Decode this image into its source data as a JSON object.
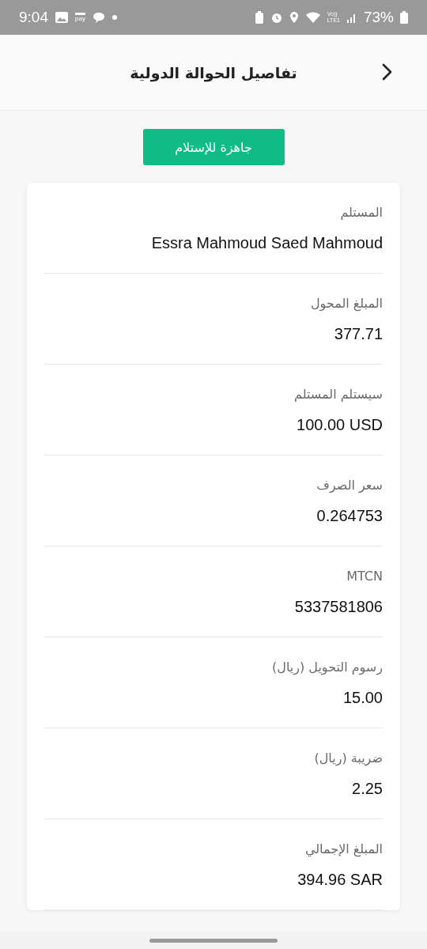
{
  "status_bar": {
    "time": "9:04",
    "pay_label": "pay",
    "volte": "Vo))",
    "network": "LTE1",
    "battery": "73%"
  },
  "header": {
    "title": "تفاصيل الحوالة الدولية"
  },
  "status_button": {
    "label": "جاهزة للإستلام"
  },
  "details": [
    {
      "label": "المستلم",
      "value": "Essra Mahmoud Saed Mahmoud"
    },
    {
      "label": "المبلغ المحول",
      "value": "377.71"
    },
    {
      "label": "سيستلم المستلم",
      "value": "100.00 USD"
    },
    {
      "label": "سعر الصرف",
      "value": "0.264753"
    },
    {
      "label": "MTCN",
      "value": "5337581806"
    },
    {
      "label": "رسوم التحويل (ريال)",
      "value": "15.00"
    },
    {
      "label": "ضريبة  (ريال)",
      "value": "2.25"
    },
    {
      "label": "المبلغ الإجمالي",
      "value": "394.96 SAR"
    }
  ]
}
